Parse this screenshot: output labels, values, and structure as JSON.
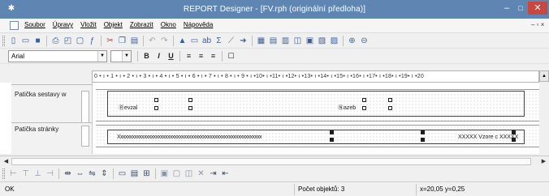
{
  "window": {
    "title": "REPORT Designer - [FV.rph (originální předloha)]",
    "app_icon": "gear-icon",
    "minimize": "–",
    "maximize": "□",
    "close": "✕"
  },
  "menubar": {
    "items": [
      "Soubor",
      "Úpravy",
      "Vložit",
      "Objekt",
      "Zobrazit",
      "Okno",
      "Nápověda"
    ],
    "mdi_controls": "– ▫ ×"
  },
  "font_toolbar": {
    "font_name": "Arial",
    "font_size": "",
    "bold": "B",
    "italic": "I",
    "underline": "U"
  },
  "ruler": {
    "text": "0 • ı • 1 • ı • 2 • ı • 3 • ı • 4 • ı • 5 • ı • 6 • ı • 7 • ı • 8 • ı • 9 • ı •10• ı •11• ı •12• ı •13• ı •14• ı •15• ı •16• ı •17• ı •18• ı •19• ı •20"
  },
  "bands": [
    {
      "label": "Patička sestavy w"
    },
    {
      "label": "Patička stránky"
    }
  ],
  "design": {
    "field_vyzkum": "Ⓡevzal",
    "field_nazeb": "Ⓝazeb",
    "field_long": "Xxxxxxxxxxxxxxxxxxxxxxxxxxxxxxxxxxxxxxxxxxxxxxxxxxxxxxxxxxxxx",
    "field_vzor": "XXXXX Vzore c XXXXX"
  },
  "status": {
    "text": "OK",
    "object_count": "Počet objektů: 3",
    "coords": "x=20,05  y=0,25"
  }
}
